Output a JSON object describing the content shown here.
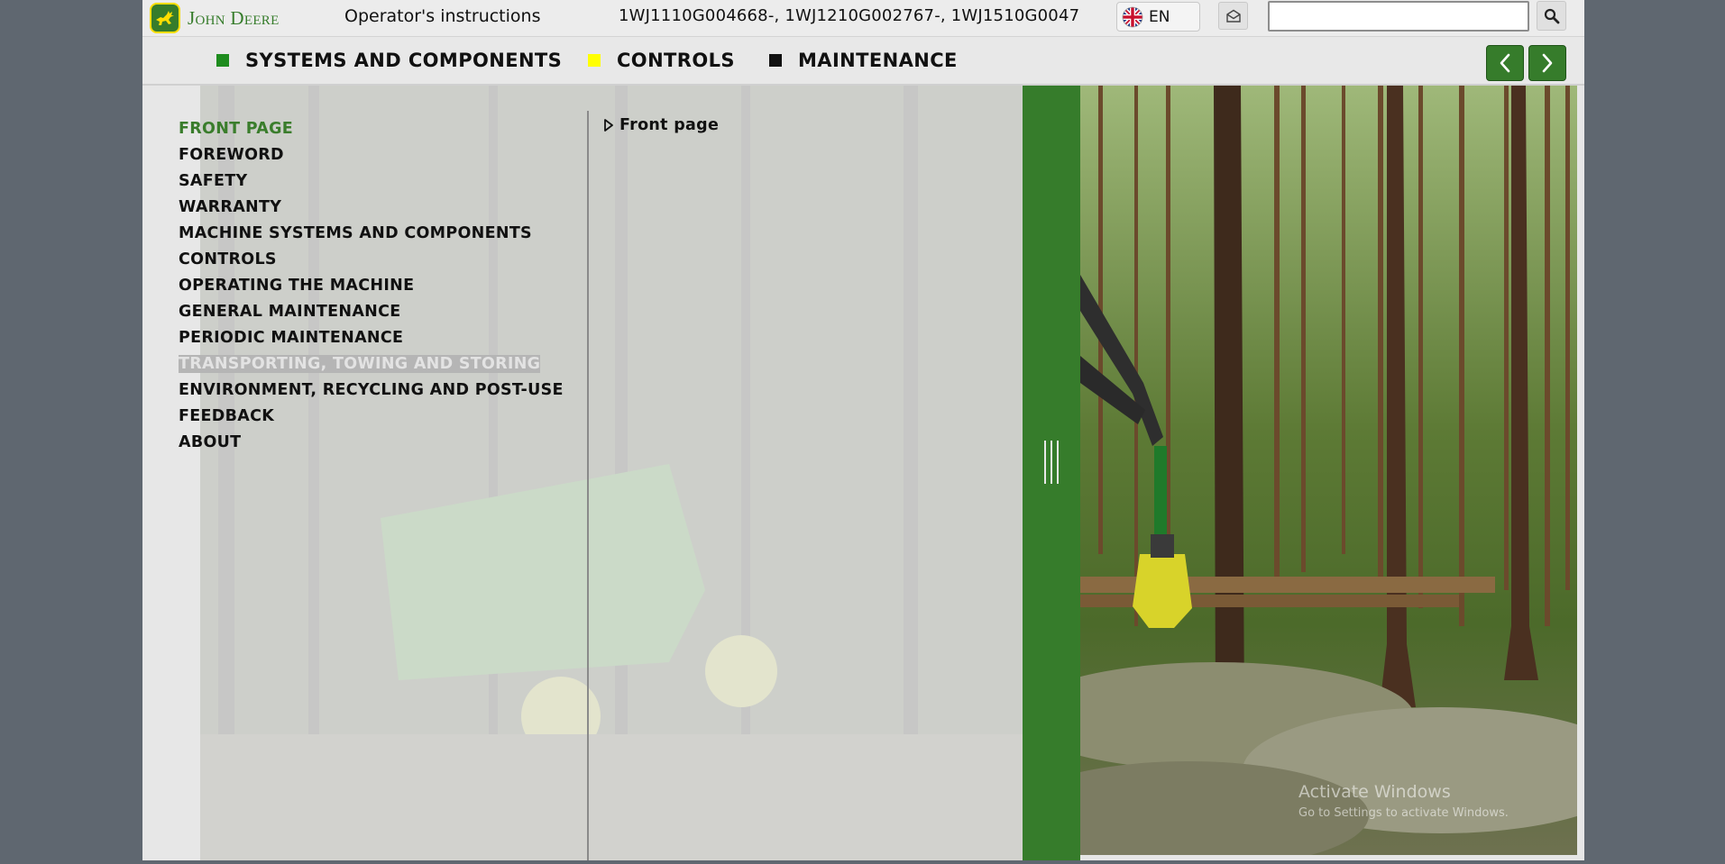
{
  "header": {
    "brand": "John Deere",
    "doc_title": "Operator's instructions",
    "serials": "1WJ1110G004668-, 1WJ1210G002767-, 1WJ1510G0047",
    "language": "EN",
    "search_placeholder": ""
  },
  "navbar": {
    "items": [
      {
        "label": "SYSTEMS AND COMPONENTS",
        "color": "#1e8c1e"
      },
      {
        "label": "CONTROLS",
        "color": "#ffff00"
      },
      {
        "label": "MAINTENANCE",
        "color": "#111111"
      }
    ]
  },
  "toc": {
    "items": [
      {
        "label": "FRONT PAGE",
        "active": true
      },
      {
        "label": "FOREWORD"
      },
      {
        "label": "SAFETY"
      },
      {
        "label": "WARRANTY"
      },
      {
        "label": "MACHINE SYSTEMS AND COMPONENTS"
      },
      {
        "label": "CONTROLS"
      },
      {
        "label": "OPERATING THE MACHINE"
      },
      {
        "label": "GENERAL MAINTENANCE"
      },
      {
        "label": "PERIODIC MAINTENANCE"
      },
      {
        "label": "TRANSPORTING, TOWING AND STORING",
        "highlighted": true
      },
      {
        "label": "ENVIRONMENT, RECYCLING AND POST-USE"
      },
      {
        "label": "FEEDBACK"
      },
      {
        "label": "ABOUT"
      }
    ]
  },
  "subpanel": {
    "item": "Front page"
  },
  "watermark": {
    "line1": "Activate Windows",
    "line2": "Go to Settings to activate Windows."
  },
  "colors": {
    "brand_green": "#367c2b",
    "brand_yellow": "#ffde00"
  }
}
